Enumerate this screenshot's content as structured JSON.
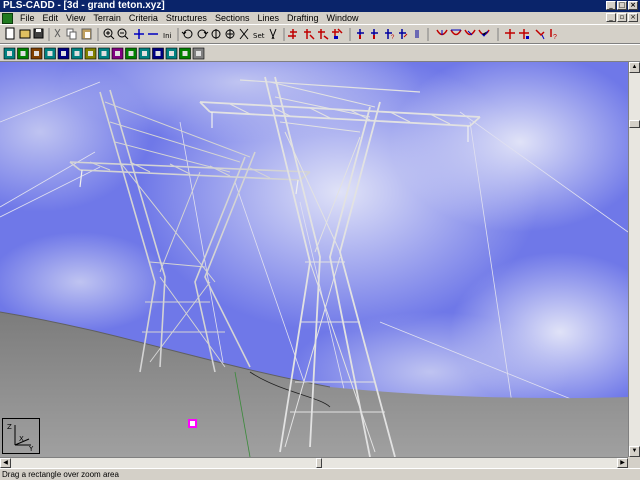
{
  "titlebar": {
    "title": "PLS-CADD - [3d - grand teton.xyz]"
  },
  "menubar": {
    "items": [
      "File",
      "Edit",
      "View",
      "Terrain",
      "Criteria",
      "Structures",
      "Sections",
      "Lines",
      "Drafting",
      "Window"
    ]
  },
  "toolbar1": {
    "buttons": [
      "new-icon",
      "open-icon",
      "save-icon",
      "cut-icon",
      "copy-icon",
      "paste-icon",
      "zoom-in-icon",
      "zoom-out-icon",
      "pan-horizontal-icon",
      "pan-vertical-icon",
      "zoom-initial-icon",
      "rotate-left-icon",
      "rotate-right-icon",
      "rotate-up-icon",
      "rotate-down-icon",
      "scale-icon",
      "set-icon",
      "scissors-icon",
      "structure-add-icon",
      "structure-move-icon",
      "structure-edit-icon",
      "structure-string-icon",
      "insulator-icon",
      "insulator-add-icon",
      "insulator-help-icon",
      "insulator-edit-icon",
      "sag-icon",
      "sag-edit-icon",
      "sag-check-icon",
      "sag-clear-icon",
      "tension-icon",
      "tension-add-icon",
      "tension-edit-icon",
      "tension-help-icon"
    ],
    "labels": {
      "zoom_initial": "Ini",
      "set": "Set"
    }
  },
  "toolbar2": {
    "count": 15
  },
  "view": {
    "axis_labels": {
      "z": "Z",
      "x": "X",
      "y": "Y"
    }
  },
  "statusbar": {
    "text": "Drag a rectangle over zoom area"
  },
  "colors": {
    "sky": "#6f78e8",
    "ground": "#8c8c8c",
    "tower": "#d8d8d8",
    "title": "#0a246a",
    "marker": "#ff00ff"
  }
}
